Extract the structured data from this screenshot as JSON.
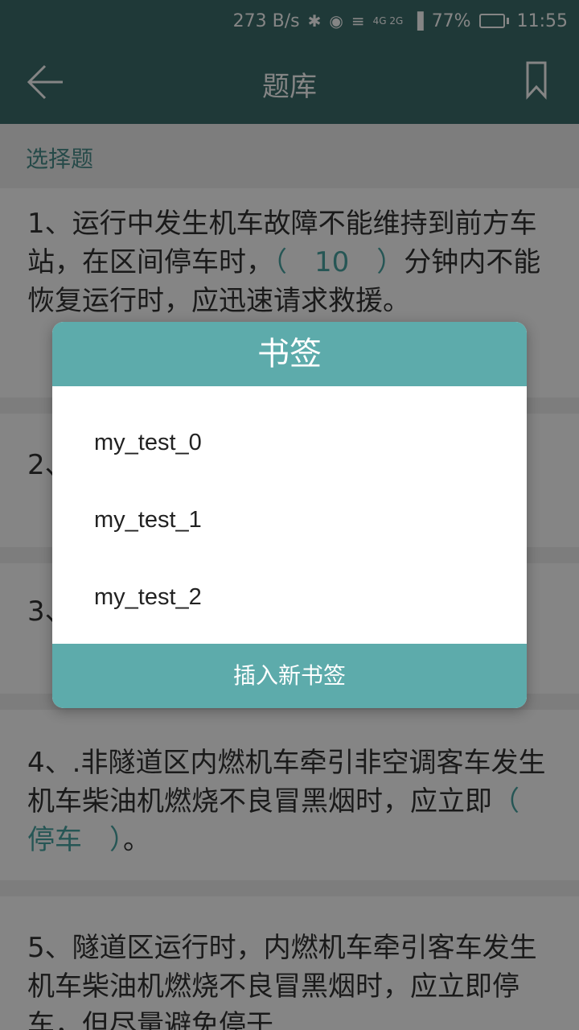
{
  "status_bar": {
    "net_speed": "273 B/s",
    "network": "4G 2G",
    "battery": "77%",
    "battery_level": 0.77,
    "time": "11:55"
  },
  "app_bar": {
    "title": "题库",
    "back_icon": "arrow-left-icon",
    "bookmark_icon": "bookmark-icon"
  },
  "section": {
    "label": "选择题"
  },
  "questions": [
    {
      "pre": "1、运行中发生机车故障不能维持到前方车站，在区间停车时，",
      "blank": "（　10　）",
      "post": "分钟内不能恢复运行时，应迅速请求救援。"
    },
    {
      "pre": "2、",
      "blank": "",
      "post": ""
    },
    {
      "pre": "3、",
      "blank": "",
      "post": ""
    },
    {
      "pre": "4、.非隧道区内燃机车牵引非空调客车发生机车柴油机燃烧不良冒黑烟时，应立即",
      "blank": "（　停车　）",
      "post": "。"
    },
    {
      "pre": "5、隧道区运行时，内燃机车牵引客车发生机车柴油机燃烧不良冒黑烟时，应立即停车，但尽量避免停于",
      "blank": "",
      "post": ""
    }
  ],
  "dialog": {
    "title": "书签",
    "items": [
      "my_test_0",
      "my_test_1",
      "my_test_2"
    ],
    "footer": "插入新书签"
  },
  "colors": {
    "appbar": "#3c6e6c",
    "dialog_accent": "#5dabab",
    "blank_text": "#4aa5a3"
  }
}
